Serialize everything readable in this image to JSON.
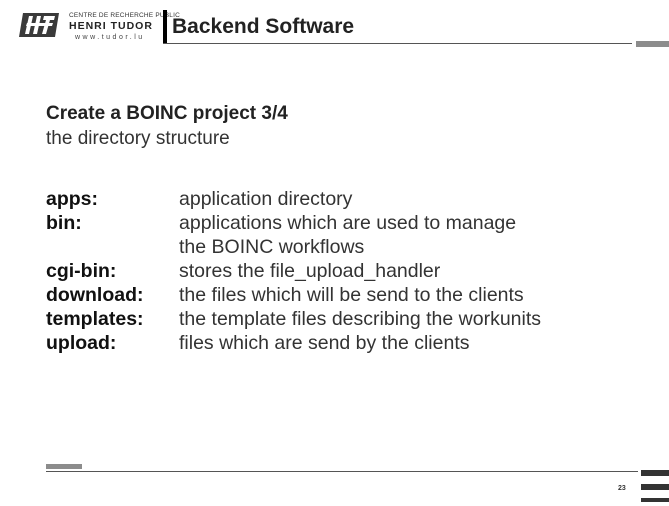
{
  "header": {
    "logo": {
      "line1": "CENTRE DE RECHERCHE PUBLIC",
      "line2": "HENRI TUDOR",
      "url": "www.tudor.lu"
    },
    "title": "Backend Software"
  },
  "content": {
    "heading": "Create a BOINC project 3/4",
    "subheading": "the directory structure",
    "definitions": [
      {
        "term": "apps:",
        "lines": [
          "application directory"
        ]
      },
      {
        "term": "bin:",
        "lines": [
          "applications which are used to manage",
          "the BOINC workflows"
        ]
      },
      {
        "term": "cgi-bin:",
        "lines": [
          "stores the file_upload_handler"
        ]
      },
      {
        "term": "download:",
        "lines": [
          "the files which will be send to the clients"
        ]
      },
      {
        "term": "templates:",
        "lines": [
          "the template files describing the workunits"
        ]
      },
      {
        "term": "upload:",
        "lines": [
          "files which are send by the clients"
        ]
      }
    ]
  },
  "footer": {
    "page_number": "23"
  }
}
